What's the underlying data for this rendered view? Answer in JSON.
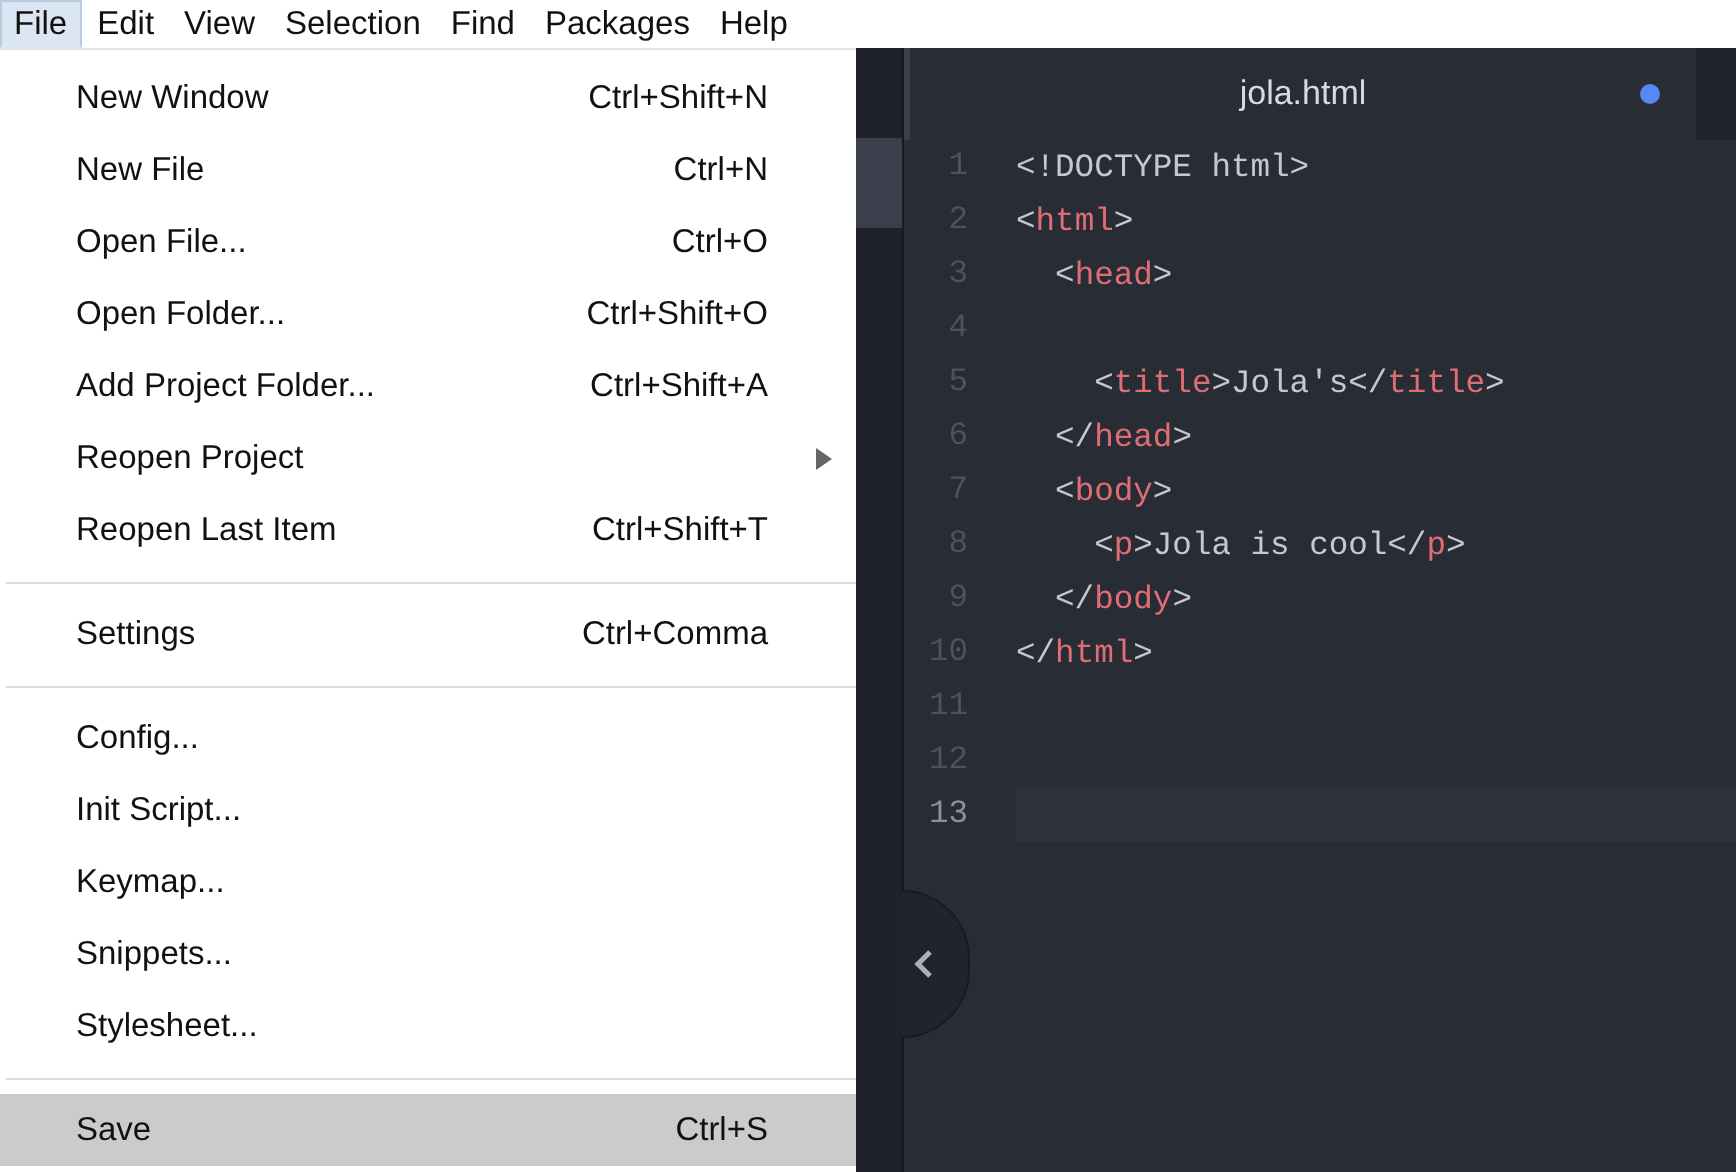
{
  "menu_bar": [
    {
      "label": "File",
      "selected": true
    },
    {
      "label": "Edit",
      "selected": false
    },
    {
      "label": "View",
      "selected": false
    },
    {
      "label": "Selection",
      "selected": false
    },
    {
      "label": "Find",
      "selected": false
    },
    {
      "label": "Packages",
      "selected": false
    },
    {
      "label": "Help",
      "selected": false
    }
  ],
  "file_menu": [
    {
      "kind": "item",
      "label": "New Window",
      "shortcut": "Ctrl+Shift+N",
      "selected": false
    },
    {
      "kind": "item",
      "label": "New File",
      "shortcut": "Ctrl+N",
      "selected": false
    },
    {
      "kind": "item",
      "label": "Open File...",
      "shortcut": "Ctrl+O",
      "selected": false
    },
    {
      "kind": "item",
      "label": "Open Folder...",
      "shortcut": "Ctrl+Shift+O",
      "selected": false
    },
    {
      "kind": "item",
      "label": "Add Project Folder...",
      "shortcut": "Ctrl+Shift+A",
      "selected": false
    },
    {
      "kind": "submenu",
      "label": "Reopen Project",
      "selected": false
    },
    {
      "kind": "item",
      "label": "Reopen Last Item",
      "shortcut": "Ctrl+Shift+T",
      "selected": false
    },
    {
      "kind": "separator"
    },
    {
      "kind": "item",
      "label": "Settings",
      "shortcut": "Ctrl+Comma",
      "selected": false
    },
    {
      "kind": "separator"
    },
    {
      "kind": "item",
      "label": "Config...",
      "selected": false
    },
    {
      "kind": "item",
      "label": "Init Script...",
      "selected": false
    },
    {
      "kind": "item",
      "label": "Keymap...",
      "selected": false
    },
    {
      "kind": "item",
      "label": "Snippets...",
      "selected": false
    },
    {
      "kind": "item",
      "label": "Stylesheet...",
      "selected": false
    },
    {
      "kind": "separator"
    },
    {
      "kind": "item",
      "label": "Save",
      "shortcut": "Ctrl+S",
      "selected": true
    }
  ],
  "editor": {
    "tab": {
      "title": "jola.html",
      "modified": true
    },
    "lines": [
      {
        "number": "1",
        "cursor": false,
        "tokens": [
          {
            "kind": "text",
            "text": "<!DOCTYPE html>"
          }
        ]
      },
      {
        "number": "2",
        "cursor": false,
        "tokens": [
          {
            "kind": "text",
            "text": "<"
          },
          {
            "kind": "tag",
            "text": "html"
          },
          {
            "kind": "text",
            "text": ">"
          }
        ]
      },
      {
        "number": "3",
        "cursor": false,
        "tokens": [
          {
            "kind": "text",
            "text": "  <"
          },
          {
            "kind": "tag",
            "text": "head"
          },
          {
            "kind": "text",
            "text": ">"
          }
        ]
      },
      {
        "number": "4",
        "cursor": false
      },
      {
        "number": "5",
        "cursor": false,
        "tokens": [
          {
            "kind": "text",
            "text": "    <"
          },
          {
            "kind": "tag",
            "text": "title"
          },
          {
            "kind": "text",
            "text": ">Jola's</"
          },
          {
            "kind": "tag",
            "text": "title"
          },
          {
            "kind": "text",
            "text": ">"
          }
        ]
      },
      {
        "number": "6",
        "cursor": false,
        "tokens": [
          {
            "kind": "text",
            "text": "  </"
          },
          {
            "kind": "tag",
            "text": "head"
          },
          {
            "kind": "text",
            "text": ">"
          }
        ]
      },
      {
        "number": "7",
        "cursor": false,
        "tokens": [
          {
            "kind": "text",
            "text": "  <"
          },
          {
            "kind": "tag",
            "text": "body"
          },
          {
            "kind": "text",
            "text": ">"
          }
        ]
      },
      {
        "number": "8",
        "cursor": false,
        "tokens": [
          {
            "kind": "text",
            "text": "    <"
          },
          {
            "kind": "tag",
            "text": "p"
          },
          {
            "kind": "text",
            "text": ">Jola is cool</"
          },
          {
            "kind": "tag",
            "text": "p"
          },
          {
            "kind": "text",
            "text": ">"
          }
        ]
      },
      {
        "number": "9",
        "cursor": false,
        "tokens": [
          {
            "kind": "text",
            "text": "  </"
          },
          {
            "kind": "tag",
            "text": "body"
          },
          {
            "kind": "text",
            "text": ">"
          }
        ]
      },
      {
        "number": "10",
        "cursor": false,
        "tokens": [
          {
            "kind": "text",
            "text": "</"
          },
          {
            "kind": "tag",
            "text": "html"
          },
          {
            "kind": "text",
            "text": ">"
          }
        ]
      },
      {
        "number": "11",
        "cursor": false
      },
      {
        "number": "12",
        "cursor": false
      },
      {
        "number": "13",
        "cursor": true
      }
    ]
  }
}
